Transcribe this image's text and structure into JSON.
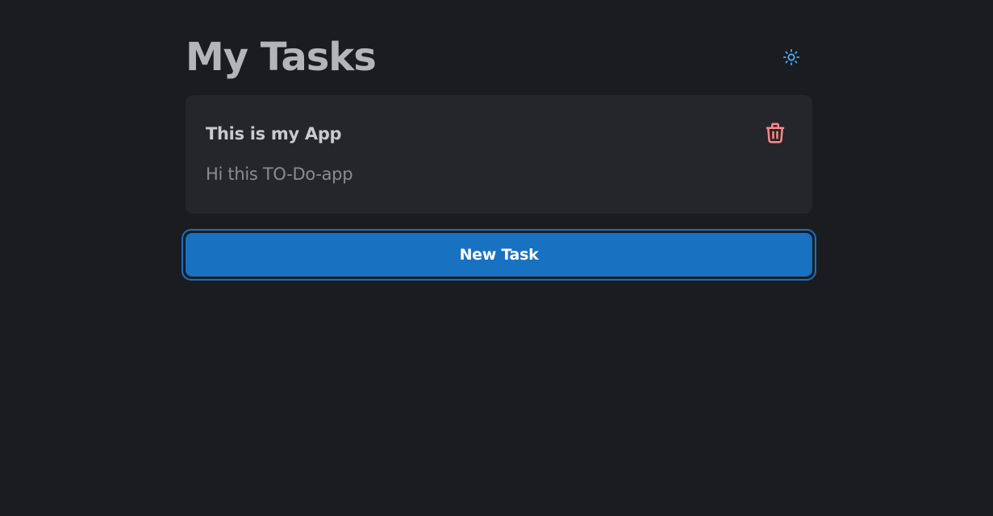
{
  "header": {
    "title": "My Tasks",
    "theme_toggle_icon": "sun-icon",
    "accent_color": "#4dabf7"
  },
  "tasks": [
    {
      "title": "This is my App",
      "description": "Hi this TO-Do-app",
      "delete_icon": "trash-icon",
      "delete_color": "#ff8787"
    }
  ],
  "actions": {
    "new_task_label": "New Task",
    "new_task_color": "#1971c2"
  },
  "colors": {
    "background": "#1b1c20",
    "card": "#25262b"
  }
}
